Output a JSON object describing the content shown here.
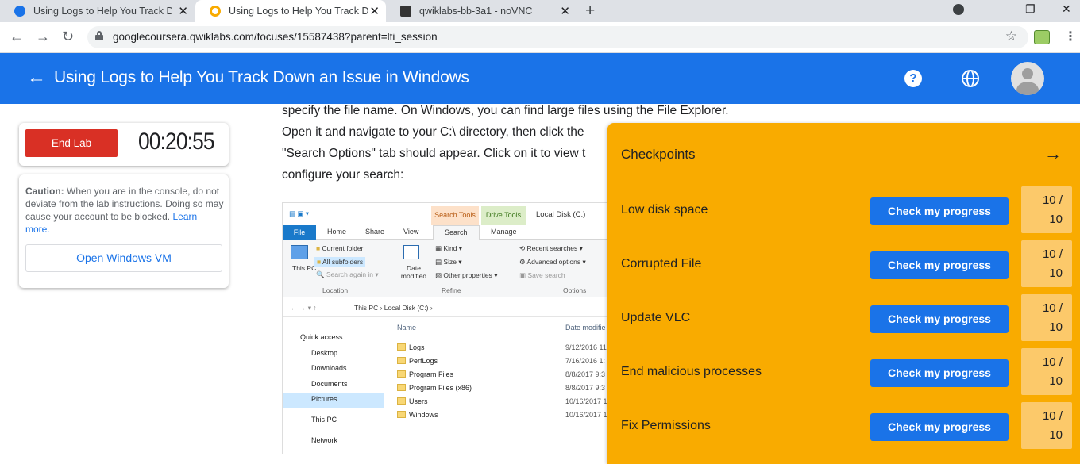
{
  "browser": {
    "tabs": [
      {
        "title": "Using Logs to Help You Track Do",
        "color": "#1a73e8"
      },
      {
        "title": "Using Logs to Help You Track Do",
        "color": "#f9ab00"
      },
      {
        "title": "qwiklabs-bb-3a1 - noVNC",
        "color": "#333333"
      }
    ],
    "url": "googlecoursera.qwiklabs.com/focuses/15587438?parent=lti_session"
  },
  "header": {
    "title": "Using Logs to Help You Track Down an Issue in Windows",
    "accent": "#1a73e8"
  },
  "lab": {
    "end_label": "End Lab",
    "timer": "00:20:55",
    "caution_bold": "Caution:",
    "caution_text": " When you are in the console, do not deviate from the lab instructions. Doing so may cause your account to be blocked.",
    "learn_more": "Learn more.",
    "open_vm": "Open Windows VM"
  },
  "instructions": {
    "lines": [
      "specify the file name. On Windows, you can find large files using the File Explorer.",
      "Open it and navigate to your C:\\ directory, then click the",
      "\"Search Options\" tab should appear. Click on it to view t",
      "configure your search:"
    ]
  },
  "explorer": {
    "ctx_search": "Search Tools",
    "ctx_drive": "Drive Tools",
    "window_title": "Local Disk (C:)",
    "tabs": [
      "File",
      "Home",
      "Share",
      "View",
      "Search",
      "Manage"
    ],
    "ribbon": {
      "this_pc": "This PC",
      "current_folder": "Current folder",
      "all_subfolders": "All subfolders",
      "search_again": "Search again in",
      "date_modified": "Date modified",
      "kind": "Kind",
      "size": "Size",
      "other_props": "Other properties",
      "recent": "Recent searches",
      "advanced": "Advanced options",
      "save_search": "Save search",
      "group_location": "Location",
      "group_refine": "Refine",
      "group_options": "Options"
    },
    "path": "This PC  ›  Local Disk (C:)  ›",
    "columns": {
      "name": "Name",
      "date": "Date modifie"
    },
    "nav": [
      "Quick access",
      "Desktop",
      "Downloads",
      "Documents",
      "Pictures",
      "This PC",
      "Network"
    ],
    "files": [
      {
        "name": "Logs",
        "date": "9/12/2016 11"
      },
      {
        "name": "PerfLogs",
        "date": "7/16/2016 1:"
      },
      {
        "name": "Program Files",
        "date": "8/8/2017 9:3"
      },
      {
        "name": "Program Files (x86)",
        "date": "8/8/2017 9:3"
      },
      {
        "name": "Users",
        "date": "10/16/2017 1"
      },
      {
        "name": "Windows",
        "date": "10/16/2017 1"
      }
    ]
  },
  "checkpoints": {
    "title": "Checkpoints",
    "button_label": "Check my progress",
    "items": [
      {
        "label": "Low disk space",
        "score": "10 /",
        "total": "10"
      },
      {
        "label": "Corrupted File",
        "score": "10 /",
        "total": "10"
      },
      {
        "label": "Update VLC",
        "score": "10 /",
        "total": "10"
      },
      {
        "label": "End malicious processes",
        "score": "10 /",
        "total": "10"
      },
      {
        "label": "Fix Permissions",
        "score": "10 /",
        "total": "10"
      }
    ]
  }
}
